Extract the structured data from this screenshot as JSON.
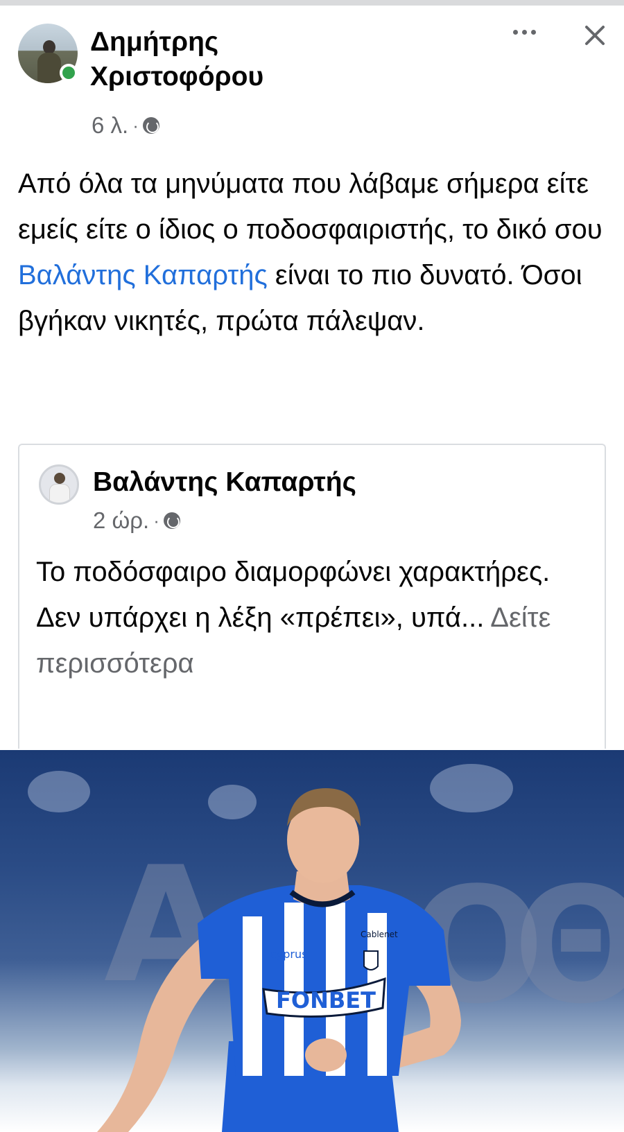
{
  "post": {
    "author": "Δημήτρης Χριστοφόρου",
    "time": "6 λ.",
    "separator": "·",
    "text_before_mention": "Από όλα τα μηνύματα που λάβαμε σήμερα είτε εμείς είτε ο ίδιος ο ποδοσφαιριστής, το δικό σου",
    "mention": "Βαλάντης Καπαρτής",
    "text_after_mention": "είναι το πιο δυνατό. Όσοι βγήκαν νικητές, πρώτα πάλεψαν.",
    "icons": {
      "more": "more-options-icon",
      "close": "close-icon",
      "audience": "globe-icon"
    }
  },
  "shared": {
    "author": "Βαλάντης Καπαρτής",
    "time": "2 ώρ.",
    "separator": "·",
    "text": "Το ποδόσφαιρο διαμορφώνει χαρακτήρες. Δεν υπάρχει η λέξη «πρέπει», υπά...",
    "see_more": "Δείτε περισσότερα"
  },
  "photo": {
    "jersey_sponsor": "cyprus",
    "jersey_sponsor_2": "Cablenet",
    "jersey_front": "FONBET",
    "colors": {
      "jersey_blue": "#1f5fd6",
      "jersey_white": "#ffffff",
      "background_blue": "#1b3a74"
    }
  },
  "colors": {
    "link": "#216fdb",
    "secondary_text": "#65676b",
    "online": "#31a24c"
  }
}
